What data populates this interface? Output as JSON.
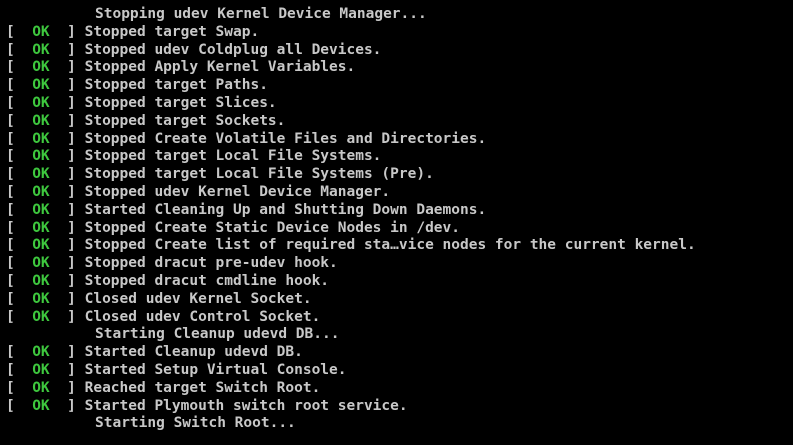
{
  "console": {
    "status_ok": "OK",
    "status_lbracket": "[",
    "status_rbracket": "]",
    "lines": [
      {
        "type": "plain",
        "text": "Stopping udev Kernel Device Manager..."
      },
      {
        "type": "ok",
        "text": "Stopped target Swap."
      },
      {
        "type": "ok",
        "text": "Stopped udev Coldplug all Devices."
      },
      {
        "type": "ok",
        "text": "Stopped Apply Kernel Variables."
      },
      {
        "type": "ok",
        "text": "Stopped target Paths."
      },
      {
        "type": "ok",
        "text": "Stopped target Slices."
      },
      {
        "type": "ok",
        "text": "Stopped target Sockets."
      },
      {
        "type": "ok",
        "text": "Stopped Create Volatile Files and Directories."
      },
      {
        "type": "ok",
        "text": "Stopped target Local File Systems."
      },
      {
        "type": "ok",
        "text": "Stopped target Local File Systems (Pre)."
      },
      {
        "type": "ok",
        "text": "Stopped udev Kernel Device Manager."
      },
      {
        "type": "ok",
        "text": "Started Cleaning Up and Shutting Down Daemons."
      },
      {
        "type": "ok",
        "text": "Stopped Create Static Device Nodes in /dev."
      },
      {
        "type": "ok",
        "text": "Stopped Create list of required sta…vice nodes for the current kernel."
      },
      {
        "type": "ok",
        "text": "Stopped dracut pre-udev hook."
      },
      {
        "type": "ok",
        "text": "Stopped dracut cmdline hook."
      },
      {
        "type": "ok",
        "text": "Closed udev Kernel Socket."
      },
      {
        "type": "ok",
        "text": "Closed udev Control Socket."
      },
      {
        "type": "plain",
        "text": "Starting Cleanup udevd DB..."
      },
      {
        "type": "ok",
        "text": "Started Cleanup udevd DB."
      },
      {
        "type": "ok",
        "text": "Started Setup Virtual Console."
      },
      {
        "type": "ok",
        "text": "Reached target Switch Root."
      },
      {
        "type": "ok",
        "text": "Started Plymouth switch root service."
      },
      {
        "type": "plain",
        "text": "Starting Switch Root..."
      }
    ]
  }
}
